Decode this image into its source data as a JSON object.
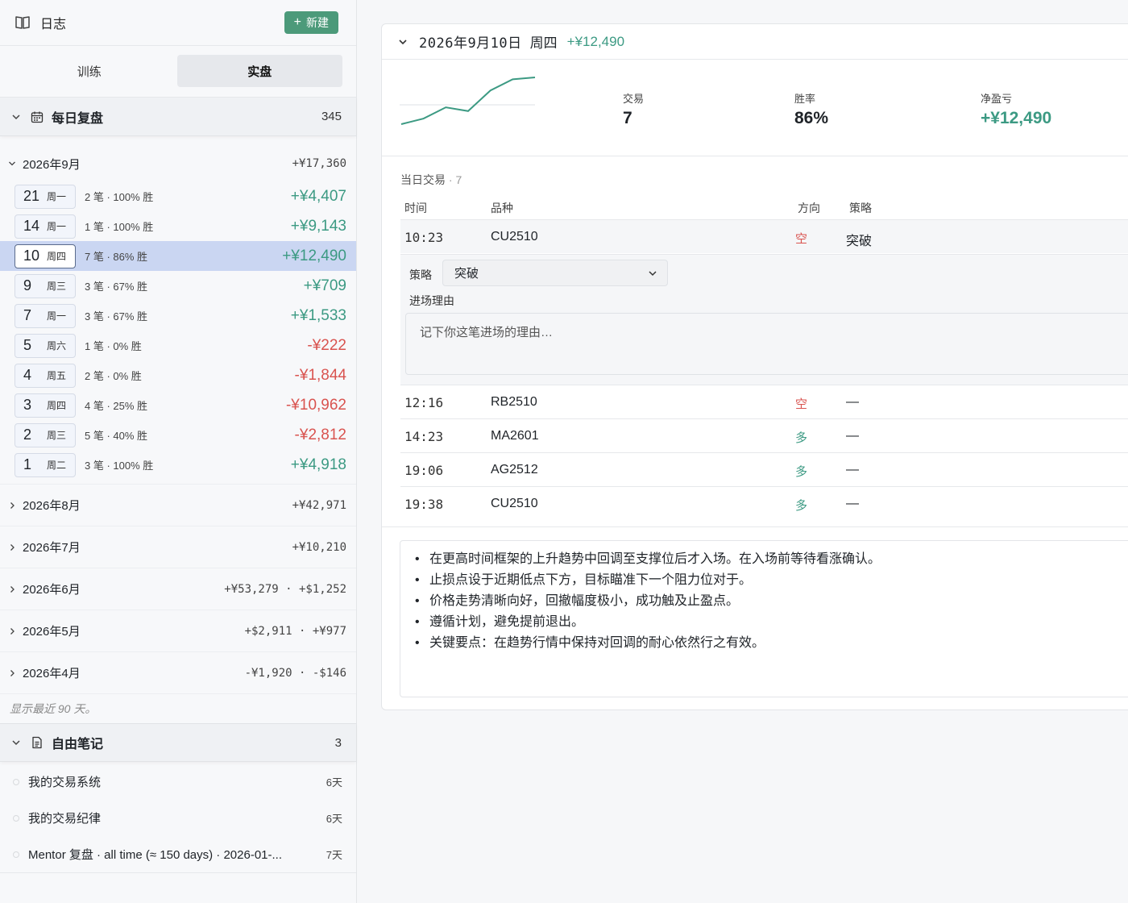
{
  "sidebar": {
    "title": "日志",
    "new_label": "新建",
    "tabs": [
      {
        "label": "训练",
        "active": false
      },
      {
        "label": "实盘",
        "active": true
      }
    ],
    "daily_section": {
      "name": "每日复盘",
      "count": "345"
    },
    "current_month": {
      "name": "2026年9月",
      "total": "+¥17,360",
      "days": [
        {
          "day": "21",
          "weekday": "周一",
          "stat": "2 笔 · 100% 胜",
          "pnl": "+¥4,407",
          "sign": "pos"
        },
        {
          "day": "14",
          "weekday": "周一",
          "stat": "1 笔 · 100% 胜",
          "pnl": "+¥9,143",
          "sign": "pos"
        },
        {
          "day": "10",
          "weekday": "周四",
          "stat": "7 笔 · 86% 胜",
          "pnl": "+¥12,490",
          "sign": "pos",
          "selected": true
        },
        {
          "day": "9",
          "weekday": "周三",
          "stat": "3 笔 · 67% 胜",
          "pnl": "+¥709",
          "sign": "pos"
        },
        {
          "day": "7",
          "weekday": "周一",
          "stat": "3 笔 · 67% 胜",
          "pnl": "+¥1,533",
          "sign": "pos"
        },
        {
          "day": "5",
          "weekday": "周六",
          "stat": "1 笔 · 0% 胜",
          "pnl": "-¥222",
          "sign": "neg"
        },
        {
          "day": "4",
          "weekday": "周五",
          "stat": "2 笔 · 0% 胜",
          "pnl": "-¥1,844",
          "sign": "neg"
        },
        {
          "day": "3",
          "weekday": "周四",
          "stat": "4 笔 · 25% 胜",
          "pnl": "-¥10,962",
          "sign": "neg"
        },
        {
          "day": "2",
          "weekday": "周三",
          "stat": "5 笔 · 40% 胜",
          "pnl": "-¥2,812",
          "sign": "neg"
        },
        {
          "day": "1",
          "weekday": "周二",
          "stat": "3 笔 · 100% 胜",
          "pnl": "+¥4,918",
          "sign": "pos"
        }
      ]
    },
    "other_months": [
      {
        "name": "2026年8月",
        "total": "+¥42,971"
      },
      {
        "name": "2026年7月",
        "total": "+¥10,210"
      },
      {
        "name": "2026年6月",
        "total": "+¥53,279 · +$1,252"
      },
      {
        "name": "2026年5月",
        "total": "+$2,911 · +¥977"
      },
      {
        "name": "2026年4月",
        "total": "-¥1,920 · -$146"
      }
    ],
    "hint": "显示最近 90 天。",
    "notes_section": {
      "name": "自由笔记",
      "count": "3"
    },
    "notes": [
      {
        "title": "我的交易系统",
        "age": "6天"
      },
      {
        "title": "我的交易纪律",
        "age": "6天"
      },
      {
        "title": "Mentor 复盘 · all time (≈ 150 days) · 2026-01-...",
        "age": "7天"
      }
    ]
  },
  "main": {
    "date": "2026年9月10日",
    "weekday": "周四",
    "pnl": "+¥12,490",
    "sparkline": [
      0,
      3,
      9,
      7,
      18,
      24,
      25
    ],
    "metrics": {
      "trades": {
        "label": "交易",
        "value": "7"
      },
      "winrate": {
        "label": "胜率",
        "value": "86%"
      },
      "net": {
        "label": "净盈亏",
        "value": "+¥12,490"
      }
    },
    "trades_title": "当日交易",
    "trades_count": "· 7",
    "columns": {
      "time": "时间",
      "symbol": "品种",
      "dir": "方向",
      "strategy": "策略"
    },
    "trades": [
      {
        "time": "10:23",
        "symbol": "CU2510",
        "dir": "空",
        "sign": "neg",
        "strategy": "突破"
      },
      {
        "time": "12:16",
        "symbol": "RB2510",
        "dir": "空",
        "sign": "neg",
        "strategy": "—"
      },
      {
        "time": "14:23",
        "symbol": "MA2601",
        "dir": "多",
        "sign": "pos",
        "strategy": "—"
      },
      {
        "time": "19:06",
        "symbol": "AG2512",
        "dir": "多",
        "sign": "pos",
        "strategy": "—"
      },
      {
        "time": "19:38",
        "symbol": "CU2510",
        "dir": "多",
        "sign": "pos",
        "strategy": "—"
      }
    ],
    "detail": {
      "strategy_label": "策略",
      "strategy_value": "突破",
      "reason_label": "进场理由",
      "reason_placeholder": "记下你这笔进场的理由…"
    },
    "notes": [
      "在更高时间框架的上升趋势中回调至支撑位后才入场。在入场前等待看涨确认。",
      "止损点设于近期低点下方，目标瞄准下一个阻力位对于。",
      "价格走势清晰向好，回撤幅度极小，成功触及止盈点。",
      "遵循计划，避免提前退出。",
      "关键要点：在趋势行情中保持对回调的耐心依然行之有效。"
    ]
  },
  "colors": {
    "positive": "#3c9a83",
    "negative": "#d9534f",
    "accent": "#4c9a7a",
    "selected_row": "#cad6f2"
  }
}
